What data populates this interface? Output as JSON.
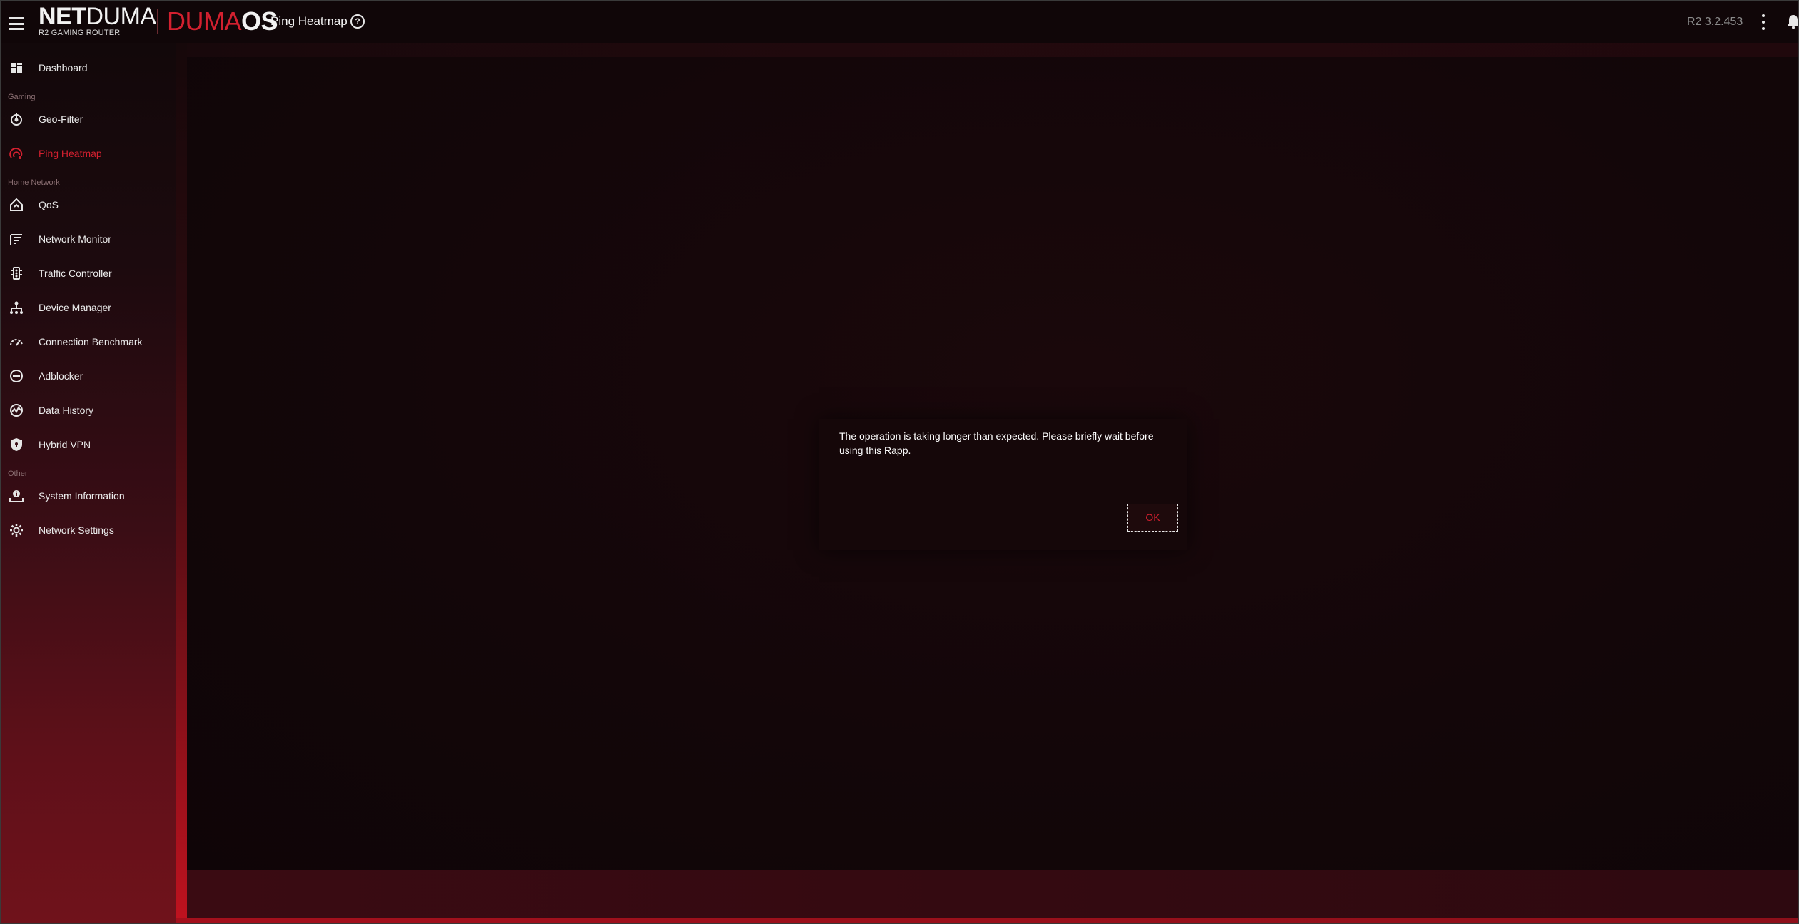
{
  "header": {
    "brand_strong": "NET",
    "brand_light": "DUMA",
    "brand_sub": "R2 GAMING ROUTER",
    "os_red": "DUMA",
    "os_white": "OS",
    "page_title": "Ping Heatmap",
    "help_glyph": "?",
    "version": "R2 3.2.453"
  },
  "sidebar": {
    "sections": {
      "gaming": "Gaming",
      "home_network": "Home Network",
      "other": "Other"
    },
    "items": [
      {
        "label": "Dashboard",
        "icon": "dashboard-icon"
      },
      {
        "label": "Geo-Filter",
        "icon": "geo-filter-icon"
      },
      {
        "label": "Ping Heatmap",
        "icon": "ping-heatmap-icon",
        "active": true
      },
      {
        "label": "QoS",
        "icon": "qos-icon"
      },
      {
        "label": "Network Monitor",
        "icon": "network-monitor-icon"
      },
      {
        "label": "Traffic Controller",
        "icon": "traffic-controller-icon"
      },
      {
        "label": "Device Manager",
        "icon": "device-manager-icon"
      },
      {
        "label": "Connection Benchmark",
        "icon": "connection-benchmark-icon"
      },
      {
        "label": "Adblocker",
        "icon": "adblocker-icon"
      },
      {
        "label": "Data History",
        "icon": "data-history-icon"
      },
      {
        "label": "Hybrid VPN",
        "icon": "hybrid-vpn-icon"
      },
      {
        "label": "System Information",
        "icon": "system-information-icon"
      },
      {
        "label": "Network Settings",
        "icon": "network-settings-icon"
      }
    ]
  },
  "dialog": {
    "message": "The operation is taking longer than expected. Please briefly wait before using this Rapp.",
    "ok_label": "OK"
  },
  "colors": {
    "accent": "#d3202f",
    "text": "#eaeaea",
    "muted": "#8a6e72",
    "background": "#0d0406"
  }
}
